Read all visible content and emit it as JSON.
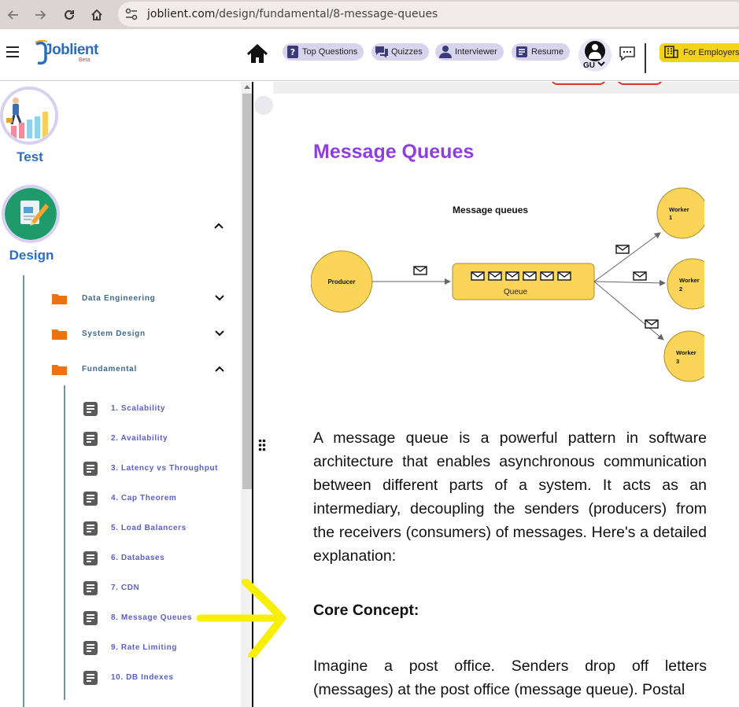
{
  "browser": {
    "url_domain": "joblient.com",
    "url_path": "/design/fundamental/8-message-queues"
  },
  "header": {
    "logo_text": "Joblient",
    "logo_beta": "Beta",
    "nav": [
      {
        "label": "Top Questions",
        "icon": "question-icon"
      },
      {
        "label": "Quizzes",
        "icon": "chat-bubbles-icon"
      },
      {
        "label": "Interviewer",
        "icon": "person-icon"
      },
      {
        "label": "Resume",
        "icon": "resume-icon"
      }
    ],
    "user_initials": "GU",
    "employers_label": "For Employers"
  },
  "sidebar": {
    "categories": [
      {
        "label": "Test",
        "icon": "growth-chart-icon"
      },
      {
        "label": "Design",
        "icon": "design-pencil-icon"
      }
    ],
    "sections": [
      {
        "label": "Data Engineering",
        "expanded": false
      },
      {
        "label": "System Design",
        "expanded": false
      },
      {
        "label": "Fundamental",
        "expanded": true
      }
    ],
    "topics": [
      "1. Scalability",
      "2. Availability",
      "3. Latency vs Throughput",
      "4. Cap Theorem",
      "5. Load Balancers",
      "6. Databases",
      "7. CDN",
      "8. Message Queues",
      "9. Rate Limiting",
      "10. DB Indexes"
    ],
    "active_topic": "8. Message Queues"
  },
  "article": {
    "title": "Message Queues",
    "diagram": {
      "title": "Message queues",
      "producer": "Producer",
      "queue": "Queue",
      "workers": [
        {
          "line1": "Worker",
          "line2": "1"
        },
        {
          "line1": "Worker",
          "line2": "2"
        },
        {
          "line1": "Worker",
          "line2": "3"
        }
      ]
    },
    "intro": "A message queue is a powerful pattern in software architecture that enables asynchronous communication between different parts of a system. It acts as an intermediary, decoupling the senders (producers) from the receivers (consumers) of messages. Here's a detailed explanation:",
    "section_heading": "Core Concept:",
    "section_text": "Imagine a post office. Senders drop off letters (messages) at the post office (message queue). Postal"
  },
  "colors": {
    "title_purple": "#8f3ee0",
    "sidebar_blue": "#2f6cc4",
    "folder_orange": "#f0720f",
    "node_yellow": "#fbd55a",
    "employers_yellow": "#f2d31a",
    "annotation_yellow": "#f7ee0a"
  }
}
